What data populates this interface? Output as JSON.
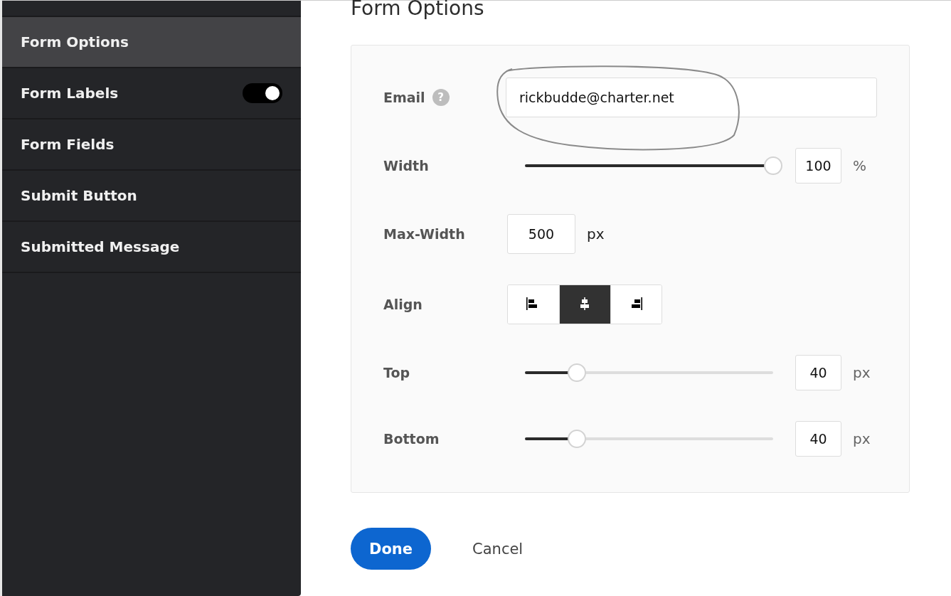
{
  "sidebar": {
    "items": [
      {
        "label": "Form Options",
        "selected": true
      },
      {
        "label": "Form Labels",
        "selected": false,
        "toggle": {
          "on": true
        }
      },
      {
        "label": "Form Fields",
        "selected": false
      },
      {
        "label": "Submit Button",
        "selected": false
      },
      {
        "label": "Submitted Message",
        "selected": false
      }
    ]
  },
  "title": "Form Options",
  "panel": {
    "rows": [
      {
        "kind": "text",
        "label": "Email",
        "help": "?",
        "value": "rickbudde@charter.net"
      },
      {
        "kind": "slider",
        "label": "Width",
        "level": 1,
        "value": "100",
        "unit": "%"
      },
      {
        "kind": "number",
        "label": "Max-Width",
        "value": "500",
        "unit": "px"
      },
      {
        "kind": "align",
        "label": "Align",
        "options": [
          {
            "kind": "left",
            "selected": false
          },
          {
            "kind": "center",
            "selected": true
          },
          {
            "kind": "right",
            "selected": false
          }
        ]
      },
      {
        "kind": "slider",
        "label": "Top",
        "level": 0.18,
        "value": "40",
        "unit": "px"
      },
      {
        "kind": "slider",
        "label": "Bottom",
        "level": 0.18,
        "value": "40",
        "unit": "px"
      }
    ]
  },
  "actions": {
    "primary": "Done",
    "secondary": "Cancel"
  }
}
